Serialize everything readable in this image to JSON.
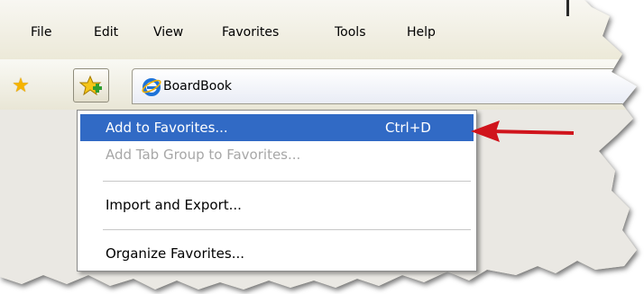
{
  "menubar": {
    "items": [
      {
        "label": "File"
      },
      {
        "label": "Edit"
      },
      {
        "label": "View"
      },
      {
        "label": "Favorites"
      },
      {
        "label": "Tools"
      },
      {
        "label": "Help"
      }
    ]
  },
  "toolbar": {
    "favorites_center_icon": "star-icon",
    "add_favorites_icon": "star-plus-icon"
  },
  "tab": {
    "title": "BoardBook",
    "icon": "ie-icon"
  },
  "dropdown": {
    "items": [
      {
        "label": "Add to Favorites...",
        "shortcut": "Ctrl+D",
        "state": "highlighted"
      },
      {
        "label": "Add Tab Group to Favorites...",
        "state": "disabled"
      },
      {
        "label": "Import and Export...",
        "state": "enabled"
      },
      {
        "label": "Organize Favorites...",
        "state": "enabled"
      }
    ]
  },
  "annotation": {
    "arrow_color": "#d0141c",
    "points_to": "Add to Favorites..."
  },
  "colors": {
    "highlight": "#316ac5",
    "chrome": "#ece9d8",
    "page_background": "#eae8e3"
  }
}
